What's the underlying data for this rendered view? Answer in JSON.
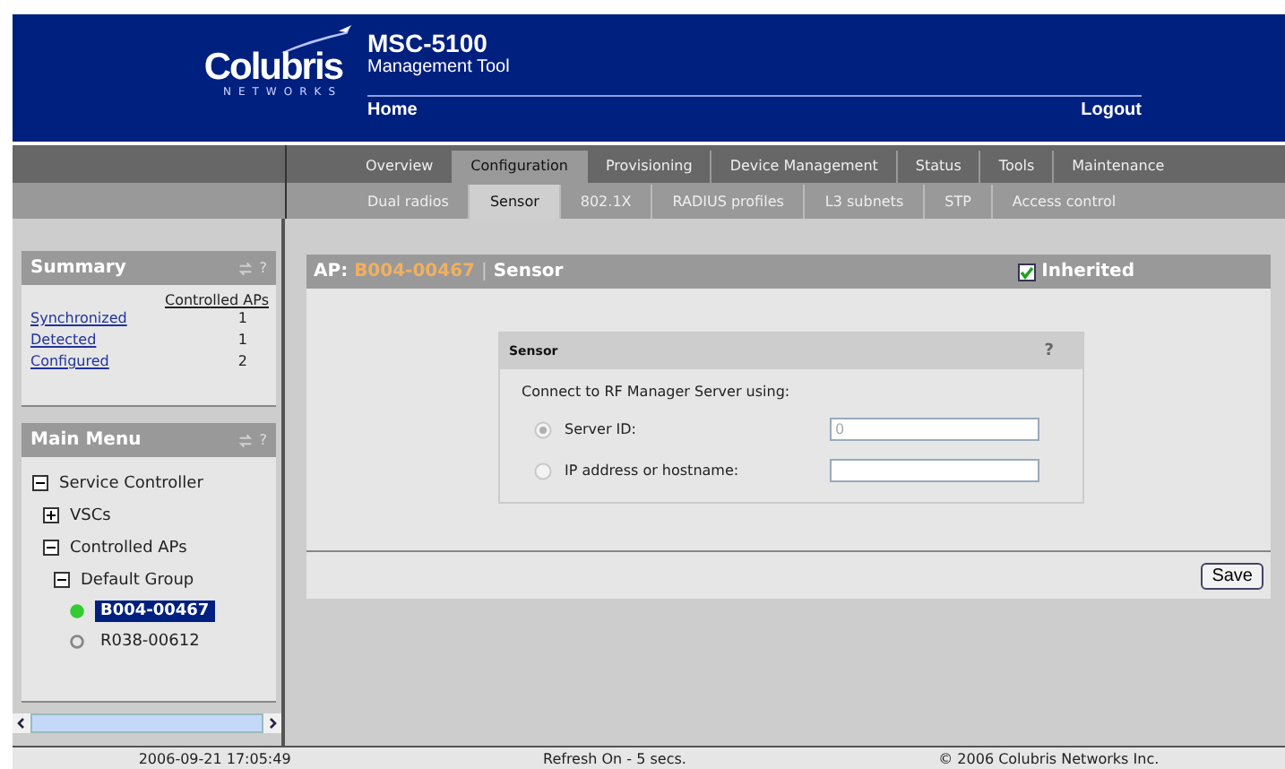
{
  "header": {
    "brand": "Colubris",
    "brand_sub": "NETWORKS",
    "product": "MSC-5100",
    "subtitle": "Management Tool",
    "links": [
      "Home",
      "Logout"
    ]
  },
  "tabs": [
    {
      "label": "Overview",
      "selected": false
    },
    {
      "label": "Configuration",
      "selected": true
    },
    {
      "label": "Provisioning",
      "selected": false
    },
    {
      "label": "Device Management",
      "selected": false
    },
    {
      "label": "Status",
      "selected": false
    },
    {
      "label": "Tools",
      "selected": false
    },
    {
      "label": "Maintenance",
      "selected": false
    }
  ],
  "subtabs": [
    {
      "label": "Dual radios",
      "selected": false
    },
    {
      "label": "Sensor",
      "selected": true
    },
    {
      "label": "802.1X",
      "selected": false
    },
    {
      "label": "RADIUS profiles",
      "selected": false
    },
    {
      "label": "L3 subnets",
      "selected": false
    },
    {
      "label": "STP",
      "selected": false
    },
    {
      "label": "Access control",
      "selected": false
    }
  ],
  "summary": {
    "title": "Summary",
    "help": "?",
    "column": "Controlled APs",
    "rows": [
      {
        "label": "Synchronized",
        "count": "1"
      },
      {
        "label": "Detected",
        "count": "1"
      },
      {
        "label": "Configured",
        "count": "2"
      }
    ]
  },
  "main_menu": {
    "title": "Main Menu",
    "help": "?",
    "tree": [
      {
        "label": "Service Controller",
        "kind": "group",
        "expanded": true,
        "children": [
          {
            "label": "VSCs",
            "kind": "group",
            "expanded": false
          },
          {
            "label": "Controlled APs",
            "kind": "group",
            "expanded": true,
            "children": [
              {
                "label": "Default Group",
                "kind": "group",
                "expanded": true,
                "children": [
                  {
                    "label": "B004-00467",
                    "kind": "ap",
                    "color": "#33cc33",
                    "selected": true
                  },
                  {
                    "label": "R038-00612",
                    "kind": "ap",
                    "color": "#888888",
                    "selected": false
                  }
                ]
              }
            ]
          }
        ]
      }
    ]
  },
  "panel": {
    "ap_label": "AP:",
    "ap_name": "B004-00467",
    "separator": "|",
    "section": "Sensor",
    "inherited": {
      "label": "Inherited",
      "checked": true
    },
    "box": {
      "title": "Sensor",
      "help": "?",
      "prompt": "Connect to RF Manager Server using:",
      "options": [
        {
          "label": "Server ID:",
          "selected": true,
          "value": "0"
        },
        {
          "label": "IP address or hostname:",
          "selected": false
        }
      ]
    },
    "save": "Save"
  },
  "status_bar": [
    "2006-09-21 17:05:49",
    "Refresh On - 5 secs.",
    "© 2006 Colubris Networks Inc."
  ]
}
